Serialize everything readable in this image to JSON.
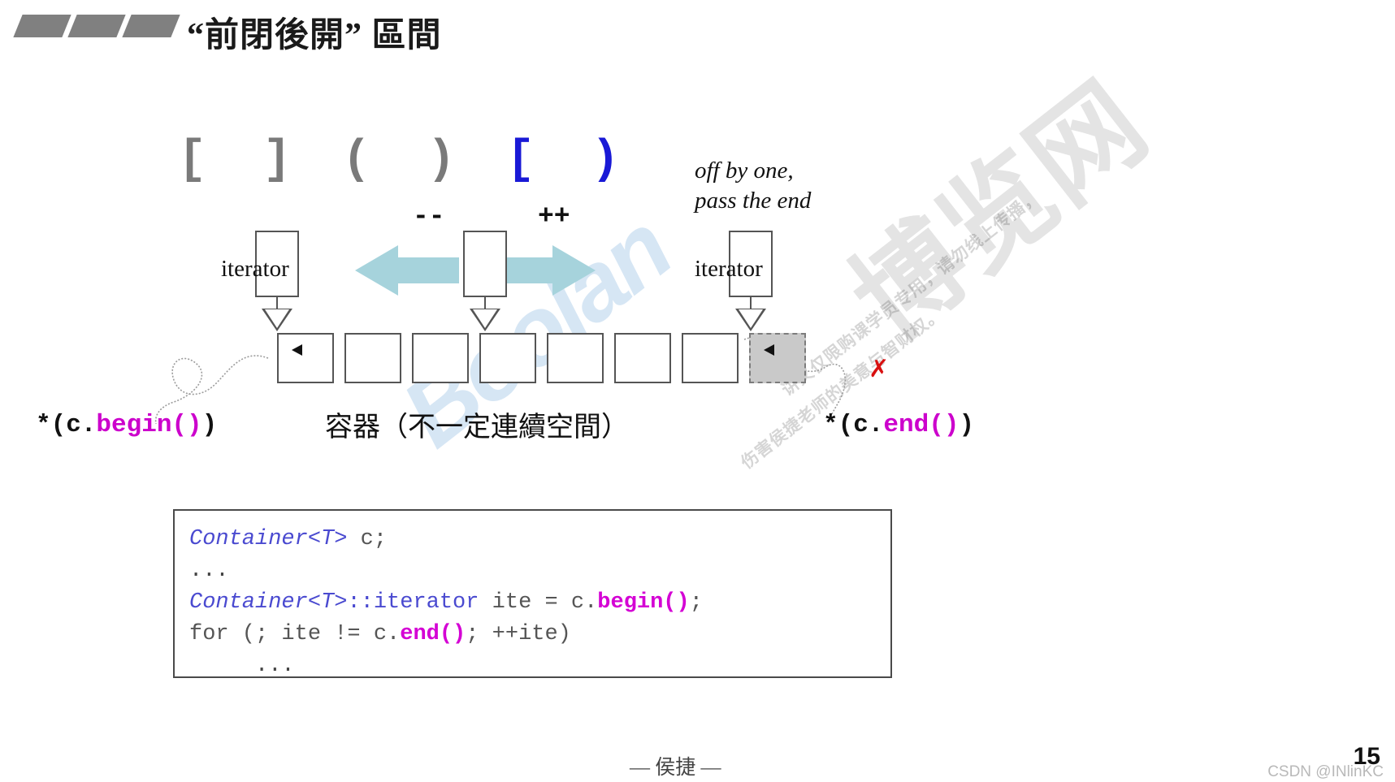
{
  "slide": {
    "title": "“前閉後開” 區間",
    "page_number": "15",
    "author_footer": "— 侯捷 —",
    "csdn_watermark": "CSDN @INlinKC"
  },
  "bullets": {
    "count": 3,
    "color": "#808080"
  },
  "bracket_row": {
    "closed_pair": "[  ]",
    "open_pair": "(  )",
    "half_open_pair": "[  )",
    "gray_color": "#7a7a7a",
    "blue_color": "#1919d6"
  },
  "diagram": {
    "iterator_begin_label": "iterator",
    "iterator_end_label": "iterator",
    "center_decrement_label": "--",
    "center_increment_label": "++",
    "off_by_one_line1": "off by one,",
    "off_by_one_line2": "pass the end",
    "container_caption": "容器（不一定連續空間）",
    "deref_begin_prefix": "*(c.",
    "deref_begin_call": "begin()",
    "deref_begin_suffix": ")",
    "deref_end_prefix": "*(c.",
    "deref_end_call": "end()",
    "deref_end_suffix": ")",
    "invalid_marker": "✗",
    "cells_count": 8,
    "arrow_color": "#a6d3dc",
    "end_cell_fill": "#c9c9c9",
    "magenta": "#cc00cc",
    "red": "#d81010"
  },
  "code": {
    "lines": [
      {
        "tmpl": "Container<T>",
        "rest": " c;"
      },
      {
        "plain": "..."
      },
      {
        "tmpl": "Container<T>",
        "ns": "::iterator",
        "mid": " ite = c.",
        "fn": "begin()",
        "tail": ";"
      },
      {
        "plain_pre": "for (; ite != c.",
        "fn": "end()",
        "plain_post": "; ++ite)"
      },
      {
        "plain_indent": "     ..."
      }
    ]
  },
  "watermarks": {
    "boolan": "Boolan",
    "bolanwang": "博览网",
    "note_line_a": "讲义仅限购课学员专用，请勿线上传播，",
    "note_line_b": "伤害侯捷老师的美意与智财权。"
  }
}
